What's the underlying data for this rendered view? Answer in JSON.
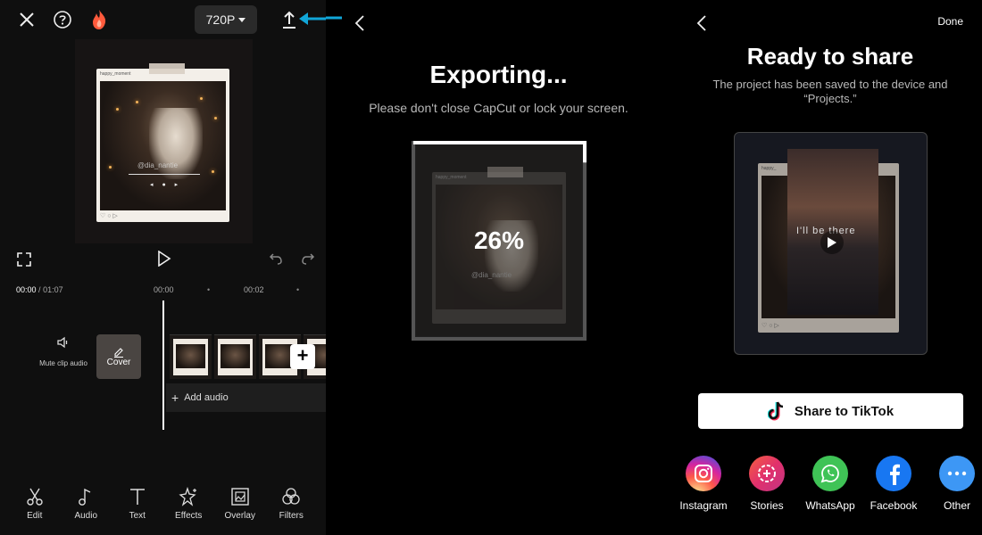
{
  "editor": {
    "resolution": "720P",
    "timecode_current": "00:00",
    "timecode_total": "01:07",
    "ruler_marks": [
      "00:00",
      "00:02"
    ],
    "mute_label": "Mute clip audio",
    "cover_label": "Cover",
    "add_audio_label": "Add audio",
    "preview_username": "happy_moment",
    "preview_caption": "@dia_nantie",
    "tools": [
      {
        "label": "Edit",
        "icon": "scissors-icon"
      },
      {
        "label": "Audio",
        "icon": "music-note-icon"
      },
      {
        "label": "Text",
        "icon": "text-icon"
      },
      {
        "label": "Effects",
        "icon": "sparkle-star-icon"
      },
      {
        "label": "Overlay",
        "icon": "overlay-image-icon"
      },
      {
        "label": "Filters",
        "icon": "filters-circles-icon"
      }
    ]
  },
  "exporting": {
    "title": "Exporting...",
    "subtitle": "Please don't close CapCut or lock your screen.",
    "percent": "26%",
    "progress": 0.26,
    "preview_username": "happy_moment",
    "preview_caption": "@dia_nantie"
  },
  "share": {
    "done_label": "Done",
    "title": "Ready to share",
    "subtitle": "The project has been saved to the device and “Projects.”",
    "preview_overlay_text": "I'll be there",
    "preview_username": "happy_",
    "tiktok_label": "Share to TikTok",
    "targets": [
      {
        "label": "Instagram",
        "icon": "instagram-icon",
        "color": "#d62976"
      },
      {
        "label": "Stories",
        "icon": "stories-icon",
        "color": "#e1306c"
      },
      {
        "label": "WhatsApp",
        "icon": "whatsapp-icon",
        "color": "#3fc356"
      },
      {
        "label": "Facebook",
        "icon": "facebook-icon",
        "color": "#1877f2"
      },
      {
        "label": "Other",
        "icon": "more-dots-icon",
        "color": "#3d97f5"
      }
    ]
  },
  "colors": {
    "annotation_arrow": "#11a6d8",
    "accent_fire": "#ff5a3c"
  }
}
